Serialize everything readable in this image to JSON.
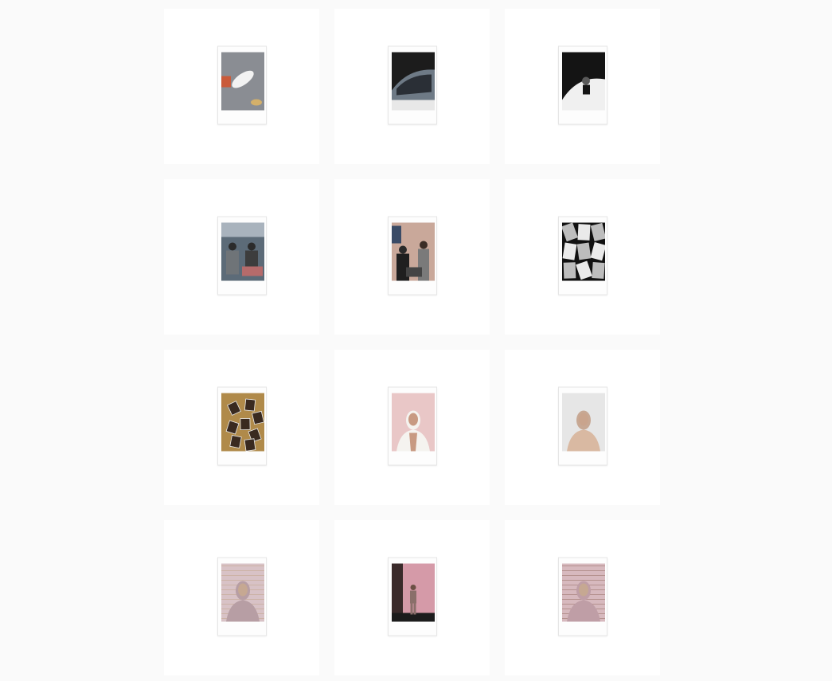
{
  "feed": {
    "posts": [
      {
        "subject": "sneakers-on-feet-photo",
        "palette": [
          "#8a8d93",
          "#f2f2f2",
          "#c95a3a",
          "#d4b06a"
        ]
      },
      {
        "subject": "person-in-car-photo",
        "palette": [
          "#1c1c1c",
          "#e8e8e8",
          "#6e7a86",
          "#2a2f36"
        ]
      },
      {
        "subject": "person-in-white-car-photo",
        "palette": [
          "#141414",
          "#f0f0f0",
          "#9a9a9a",
          "#5a5a5a"
        ]
      },
      {
        "subject": "people-at-table-outdoors-photo",
        "palette": [
          "#5c6b78",
          "#8a6f5c",
          "#2b2b2b",
          "#a9b3bd"
        ]
      },
      {
        "subject": "people-at-counter-photo",
        "palette": [
          "#c9a89a",
          "#3a4b66",
          "#2a2a2a",
          "#8a8a8a"
        ]
      },
      {
        "subject": "monochrome-collage-photo",
        "palette": [
          "#111111",
          "#eaeaea",
          "#7a7a7a",
          "#bdbdbd"
        ]
      },
      {
        "subject": "red-prints-on-table-photo",
        "palette": [
          "#b08a4a",
          "#b3241e",
          "#3a2a20",
          "#d86a55"
        ]
      },
      {
        "subject": "portrait-woman-pink-backdrop-photo",
        "palette": [
          "#e9c7c7",
          "#1e1b1a",
          "#f5f3ef",
          "#c89a82"
        ]
      },
      {
        "subject": "portrait-woman-white-backdrop-photo",
        "palette": [
          "#e6e6e6",
          "#2a221d",
          "#c7a894",
          "#d9b9a2"
        ]
      },
      {
        "subject": "portrait-woman-brick-wall-photo",
        "palette": [
          "#d8c2c6",
          "#141414",
          "#b79ea4",
          "#c6a892"
        ]
      },
      {
        "subject": "person-standing-pink-wall-photo",
        "palette": [
          "#d59aa8",
          "#3a3230",
          "#8a6f6a",
          "#1c1c1c"
        ]
      },
      {
        "subject": "portrait-brick-wall-photo",
        "palette": [
          "#d7b9be",
          "#1b1a1a",
          "#bf9ea6",
          "#a07a72"
        ]
      }
    ]
  }
}
